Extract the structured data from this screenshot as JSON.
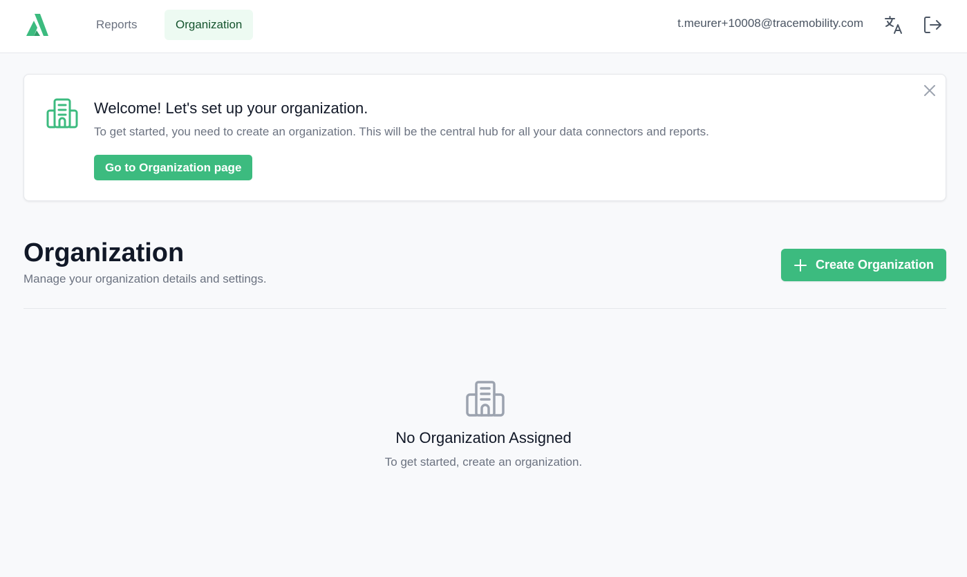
{
  "header": {
    "nav": [
      {
        "label": "Reports",
        "active": false
      },
      {
        "label": "Organization",
        "active": true
      }
    ],
    "user_email": "t.meurer+10008@tracemobility.com",
    "icons": [
      "translate-icon",
      "logout-icon"
    ]
  },
  "welcome": {
    "title": "Welcome! Let's set up your organization.",
    "text": "To get started, you need to create an organization. This will be the central hub for all your data connectors and reports.",
    "button_label": "Go to Organization page",
    "icon": "building-icon"
  },
  "main": {
    "title": "Organization",
    "subtitle": "Manage your organization details and settings.",
    "create_button_label": "Create Organization",
    "empty_state": {
      "title": "No Organization Assigned",
      "text": "To get started, create an organization."
    }
  },
  "colors": {
    "brand_green": "#3cbb7f",
    "active_nav_bg": "#edfaf2",
    "active_nav_text": "#14532d",
    "muted_icon": "#9ca3af"
  }
}
